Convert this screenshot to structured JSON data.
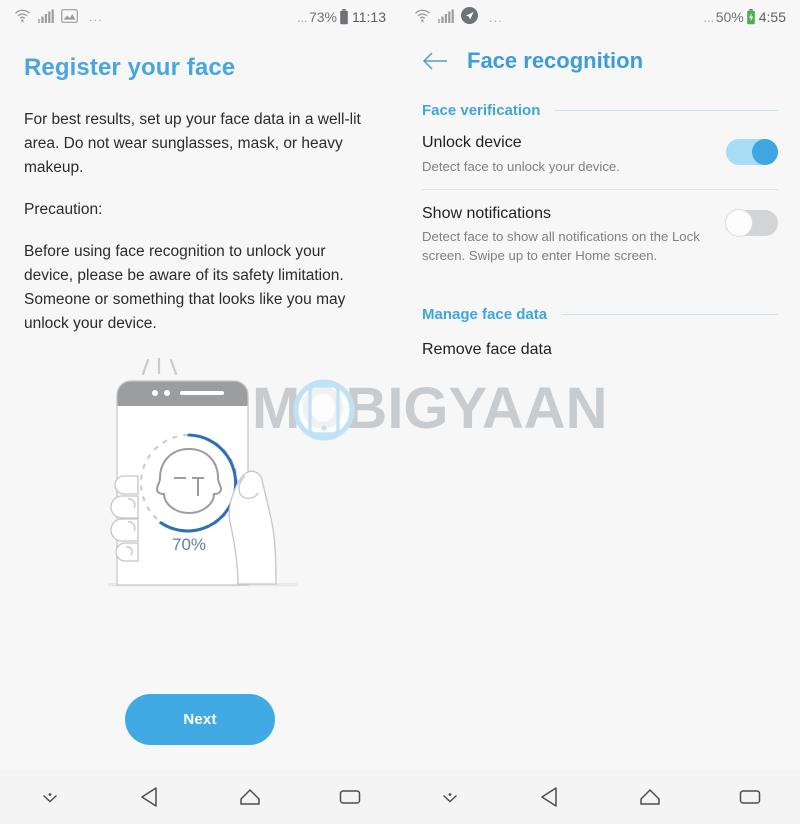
{
  "left_screen": {
    "status_bar": {
      "icons": [
        "wifi-icon",
        "signal-icon",
        "screenshot-icon"
      ],
      "overflow": "...",
      "battery_prefix": "...",
      "battery_percent": "73%",
      "battery_icon": "battery-icon",
      "time": "11:13"
    },
    "title": "Register your face",
    "paragraphs": [
      "For best results, set up your face data in a well-lit area. Do not wear sunglasses, mask, or heavy makeup.",
      "Precaution:",
      "Before using face recognition to unlock your device, please be aware of its safety limitation. Someone or something that looks like you may unlock your device."
    ],
    "illustration": {
      "name": "face-scan-illustration",
      "progress_label": "70%",
      "progress_percent": 70,
      "phone_color": "#9b9d9f",
      "arc_color": "#2e6fb7",
      "face_color": "#9a9c9e"
    },
    "next_button": "Next"
  },
  "right_screen": {
    "status_bar": {
      "icons": [
        "wifi-icon",
        "signal-icon",
        "location-icon"
      ],
      "overflow": "...",
      "battery_prefix": "...",
      "battery_percent": "50%",
      "battery_icon": "battery-icon",
      "time": "4:55"
    },
    "back_icon": "back-arrow-icon",
    "title": "Face recognition",
    "sections": [
      {
        "label": "Face verification",
        "rows": [
          {
            "title": "Unlock device",
            "subtitle": "Detect face to unlock your device.",
            "toggle": "on"
          },
          {
            "title": "Show notifications",
            "subtitle": "Detect face to show all notifications on the Lock screen. Swipe up to enter Home screen.",
            "toggle": "off"
          }
        ]
      },
      {
        "label": "Manage face data",
        "items": [
          {
            "title": "Remove face data"
          }
        ]
      }
    ]
  },
  "watermark": {
    "text_before": "M",
    "text_after": "BIGYAAN",
    "full_text": "MOBIGYAAN",
    "color": "#c9cccf",
    "accent_color": "#bfe3f5"
  },
  "nav_bar": {
    "buttons": [
      {
        "name": "hide-keyboard-icon",
        "label": "hide"
      },
      {
        "name": "back-icon",
        "label": "back"
      },
      {
        "name": "home-icon",
        "label": "home"
      },
      {
        "name": "recents-icon",
        "label": "recents"
      }
    ]
  },
  "colors": {
    "accent_blue": "#3fa6dd",
    "title_blue": "#49a7dd",
    "button_blue": "#41aae4",
    "background": "#f7f7f7",
    "text_primary": "#1f1f1f",
    "text_secondary": "#7d8084"
  }
}
